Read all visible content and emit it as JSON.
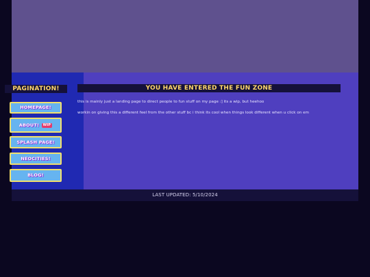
{
  "sidebar": {
    "title": "PAGINATION!",
    "items": [
      {
        "label": "HOMEPAGE!"
      },
      {
        "label": "ABOUT!",
        "badge": "WIP"
      },
      {
        "label": "SPLASH PAGE!"
      },
      {
        "label": "NEOCITIES!"
      },
      {
        "label": "BLOG!"
      }
    ]
  },
  "main": {
    "title": "YOU HAVE ENTERED THE FUN ZONE",
    "paragraphs": [
      "this is mainly just a landing page to direct people to fun stuff on my page :] its a wip, but heehoo",
      "workin on giving this a different feel from the other stuff bc i think its cool when things look different when u click on em"
    ]
  },
  "footer": {
    "text": "LAST UPDATED: 5/10/2024"
  },
  "colors": {
    "banner": "#5f518e",
    "sidebar": "#2029b2",
    "main": "#4f3fbf",
    "title_bg": "#15113a",
    "title_text": "#ffd66b",
    "button": "#66b4f0",
    "button_border": "#f3e06b",
    "badge": "#e43b6c",
    "page_bg": "#0b0720"
  }
}
